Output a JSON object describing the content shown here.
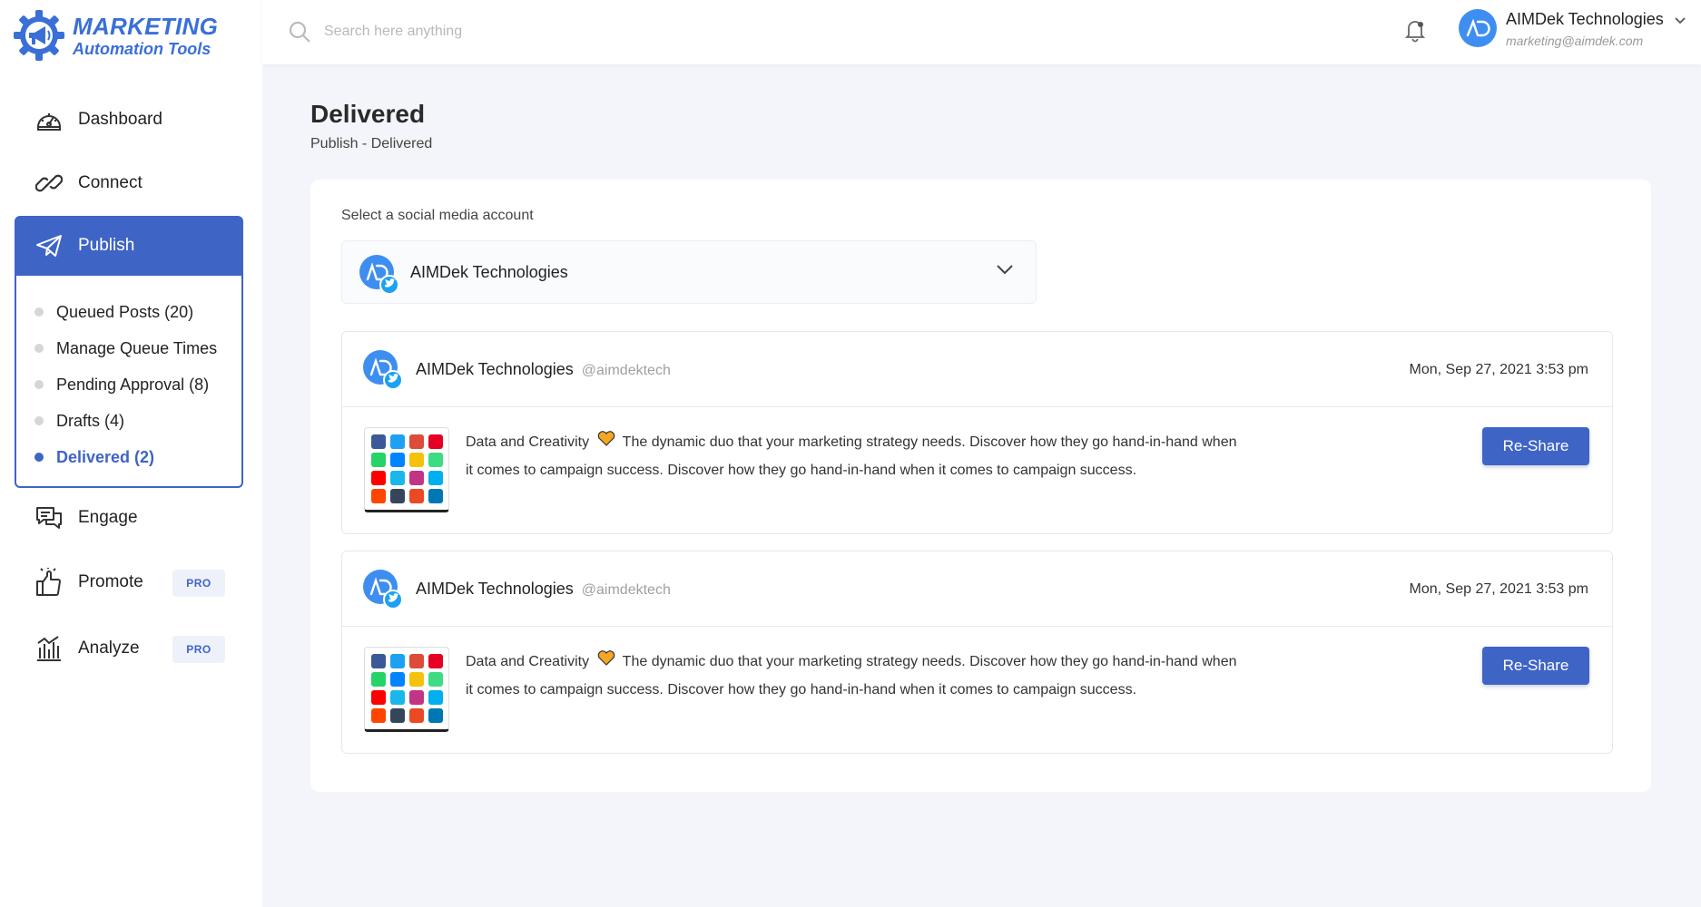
{
  "brand": {
    "line1": "MARKETING",
    "line2": "Automation Tools",
    "color": "#3a6fd8"
  },
  "sidebar": {
    "items": [
      {
        "label": "Dashboard",
        "icon": "speedometer-icon"
      },
      {
        "label": "Connect",
        "icon": "link-icon"
      },
      {
        "label": "Publish",
        "icon": "paper-plane-icon",
        "active": true
      },
      {
        "label": "Engage",
        "icon": "chat-bubbles-icon"
      },
      {
        "label": "Promote",
        "icon": "thumbs-up-icon",
        "badge": "PRO"
      },
      {
        "label": "Analyze",
        "icon": "bar-chart-icon",
        "badge": "PRO"
      }
    ],
    "publish_submenu": [
      {
        "label": "Queued Posts (20)"
      },
      {
        "label": "Manage Queue Times"
      },
      {
        "label": "Pending Approval (8)"
      },
      {
        "label": "Drafts (4)"
      },
      {
        "label": "Delivered (2)",
        "active": true
      }
    ]
  },
  "header": {
    "search": {
      "placeholder": "Search here anything",
      "value": ""
    },
    "user": {
      "name": "AIMDek Technologies",
      "email": "marketing@aimdek.com"
    }
  },
  "main": {
    "title": "Delivered",
    "breadcrumb": "Publish - Delivered",
    "select_label": "Select a social media account",
    "selected_account": "AIMDek Technologies",
    "posts": [
      {
        "account": "AIMDek Technologies",
        "handle": "@aimdektech",
        "timestamp": "Mon, Sep 27, 2021 3:53 pm",
        "text_before": "Data and Creativity",
        "text_after": "The dynamic duo that your marketing strategy needs. Discover how they go hand-in-hand when it comes to campaign success. Discover how they go hand-in-hand when it comes to campaign success.",
        "button": "Re-Share"
      },
      {
        "account": "AIMDek Technologies",
        "handle": "@aimdektech",
        "timestamp": "Mon, Sep 27, 2021 3:53 pm",
        "text_before": "Data and Creativity",
        "text_after": "The dynamic duo that your marketing strategy needs. Discover how they go hand-in-hand when it comes to campaign success. Discover how they go hand-in-hand when it comes to campaign success.",
        "button": "Re-Share"
      }
    ]
  },
  "colors": {
    "accent": "#3e64c6",
    "avatar": "#3e8ef1",
    "twitter": "#1da1f2",
    "background": "#f4f5fa"
  }
}
